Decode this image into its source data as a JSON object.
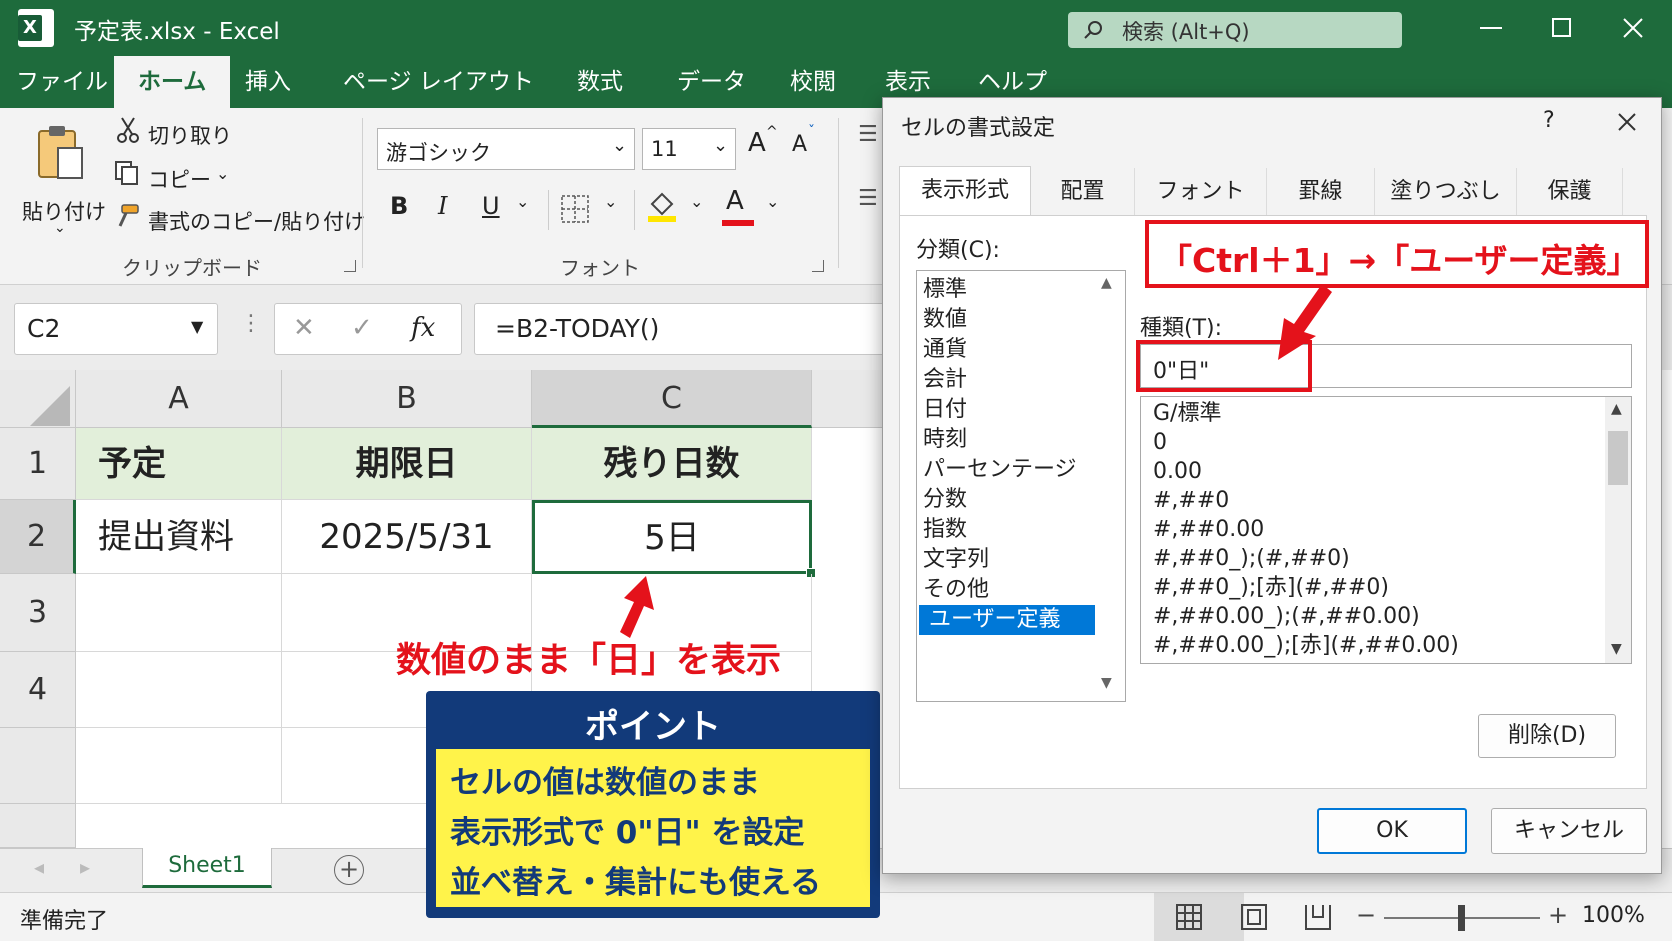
{
  "window": {
    "title": "予定表.xlsx  -  Excel",
    "app_icon": "X",
    "search_placeholder": "検索 (Alt+Q)"
  },
  "colors": {
    "excel_green": "#1e6b3c",
    "callout_red": "#e4121b",
    "point_navy": "#123a7a",
    "point_yellow": "#fff34a",
    "header_green": "#e2efda",
    "selection_blue": "#0078d7"
  },
  "ribbon_tabs": [
    "ファイル",
    "ホーム",
    "挿入",
    "ページ レイアウト",
    "数式",
    "データ",
    "校閲",
    "表示",
    "ヘルプ"
  ],
  "ribbon": {
    "paste": "貼り付け",
    "cut": "切り取り",
    "copy": "コピー",
    "format_painter": "書式のコピー/貼り付け",
    "clipboard_group": "クリップボード",
    "font_name": "游ゴシック",
    "font_size": "11",
    "font_group": "フォント",
    "bold": "B",
    "italic": "I",
    "underline": "U",
    "grow": "A",
    "shrink": "A",
    "font_color": "A"
  },
  "formula_bar": {
    "name_box": "C2",
    "formula": "=B2-TODAY()",
    "cancel": "✕",
    "enter": "✓",
    "fx": "fx"
  },
  "grid": {
    "columns": [
      "A",
      "B",
      "C"
    ],
    "rows": [
      "1",
      "2",
      "3",
      "4"
    ],
    "r1": [
      "予定",
      "期限日",
      "残り日数"
    ],
    "r2": [
      "提出資料",
      "2025/5/31",
      "5日"
    ]
  },
  "sheet": {
    "tab": "Sheet1",
    "add": "+"
  },
  "status": {
    "ready": "準備完了",
    "zoom": "100%",
    "minus": "−",
    "plus": "+"
  },
  "dialog": {
    "title": "セルの書式設定",
    "help": "?",
    "close": "✕",
    "tabs": [
      "表示形式",
      "配置",
      "フォント",
      "罫線",
      "塗りつぶし",
      "保護"
    ],
    "category_label": "分類(C):",
    "categories": [
      "標準",
      "数値",
      "通貨",
      "会計",
      "日付",
      "時刻",
      "パーセンテージ",
      "分数",
      "指数",
      "文字列",
      "その他",
      "ユーザー定義"
    ],
    "type_label": "種類(T):",
    "type_value": "0\"日\"",
    "formats": [
      "G/標準",
      "0",
      "0.00",
      "#,##0",
      "#,##0.00",
      "#,##0_);(#,##0)",
      "#,##0_);[赤](#,##0)",
      "#,##0.00_);(#,##0.00)",
      "#,##0.00_);[赤](#,##0.00)"
    ],
    "delete": "削除(D)",
    "ok": "OK",
    "cancel": "キャンセル"
  },
  "callouts": {
    "shortcut": "「Ctrl＋1」→「ユーザー定義」",
    "display": "数値のまま「日」を表示",
    "point_title": "ポイント",
    "point_lines": [
      "セルの値は数値のまま",
      "表示形式で 0\"日\" を設定",
      "並べ替え・集計にも使える"
    ]
  }
}
